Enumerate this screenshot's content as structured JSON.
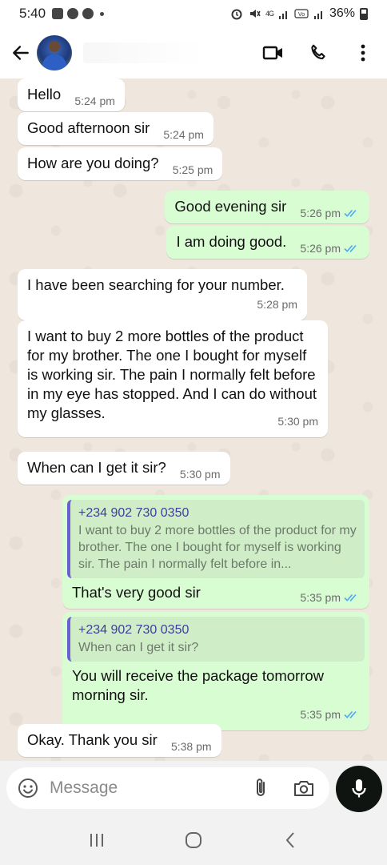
{
  "status_bar": {
    "time": "5:40",
    "network": "4G",
    "battery": "36%",
    "icons": [
      "gallery-icon",
      "app-notification-icon",
      "app-notification-icon",
      "more-dot-icon",
      "alarm-icon",
      "mute-icon",
      "signal-icon",
      "volte-icon",
      "signal-icon",
      "battery-icon"
    ]
  },
  "header": {
    "icons": [
      "back-arrow-icon",
      "avatar",
      "video-call-icon",
      "voice-call-icon",
      "more-vert-icon"
    ]
  },
  "messages": [
    {
      "dir": "in",
      "text": "Hello",
      "time": "5:24 pm"
    },
    {
      "dir": "in",
      "text": "Good afternoon sir",
      "time": "5:24 pm"
    },
    {
      "dir": "in",
      "text": "How are you doing?",
      "time": "5:25 pm"
    },
    {
      "dir": "out",
      "text": "Good evening sir",
      "time": "5:26 pm"
    },
    {
      "dir": "out",
      "text": "I am doing good.",
      "time": "5:26 pm"
    },
    {
      "dir": "in",
      "text": "I have been searching for your number.",
      "time": "5:28 pm"
    },
    {
      "dir": "in",
      "text": "I want to buy 2 more bottles of the product for my brother. The one I bought for myself is working sir. The pain I normally felt before in my eye has stopped. And I can do without my glasses.",
      "time": "5:30 pm"
    },
    {
      "dir": "in",
      "text": "When can I get it sir?",
      "time": "5:30 pm"
    },
    {
      "dir": "out",
      "quote_name": "+234 902 730 0350",
      "quote_text": "I want to buy 2 more bottles of the product for my brother. The one I bought for myself is working sir. The pain I normally felt before in...",
      "text": "That's very good sir",
      "time": "5:35 pm"
    },
    {
      "dir": "out",
      "quote_name": "+234 902 730 0350",
      "quote_text": "When can I get it sir?",
      "text": "You will receive the package tomorrow morning sir.",
      "time": "5:35 pm"
    },
    {
      "dir": "in",
      "text": "Okay. Thank you sir",
      "time": "5:38 pm"
    }
  ],
  "composer": {
    "placeholder": "Message",
    "icons": [
      "emoji-icon",
      "attach-icon",
      "camera-icon",
      "mic-icon"
    ]
  },
  "navbar": {
    "icons": [
      "recent-apps-icon",
      "home-icon",
      "back-icon"
    ]
  },
  "colors": {
    "incoming_bubble": "#ffffff",
    "outgoing_bubble": "#d9fdd3",
    "chat_background": "#efe7dd",
    "read_ticks": "#4fa8f0",
    "quote_bar": "#6b5fd1"
  }
}
